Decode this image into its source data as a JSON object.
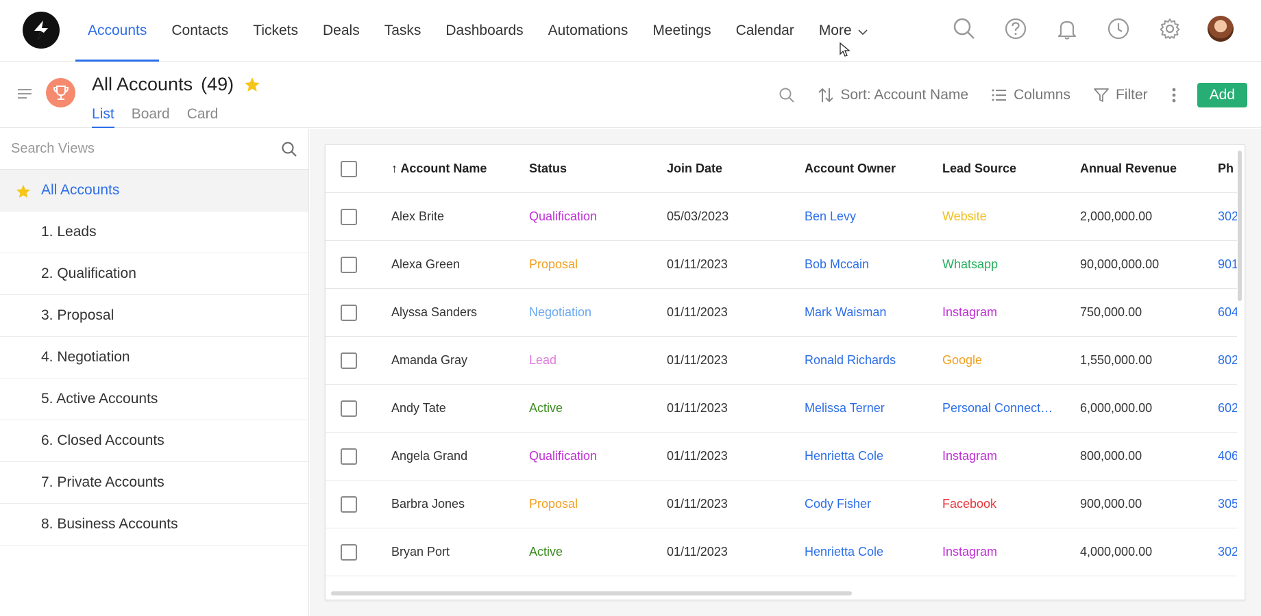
{
  "nav": {
    "items": [
      {
        "label": "Accounts",
        "active": true
      },
      {
        "label": "Contacts"
      },
      {
        "label": "Tickets"
      },
      {
        "label": "Deals"
      },
      {
        "label": "Tasks"
      },
      {
        "label": "Dashboards"
      },
      {
        "label": "Automations"
      },
      {
        "label": "Meetings"
      },
      {
        "label": "Calendar"
      }
    ],
    "more_label": "More",
    "icons": [
      "search-icon",
      "help-icon",
      "bell-icon",
      "clock-icon",
      "gear-icon"
    ]
  },
  "header": {
    "title": "All Accounts",
    "count": "(49)",
    "view_tabs": [
      "List",
      "Board",
      "Card"
    ],
    "sort_label": "Sort: Account Name",
    "columns_label": "Columns",
    "filter_label": "Filter",
    "add_label": "Add"
  },
  "sidebar": {
    "search_placeholder": "Search Views",
    "views": [
      {
        "label": "All Accounts",
        "active": true
      },
      {
        "label": "1. Leads"
      },
      {
        "label": "2. Qualification"
      },
      {
        "label": "3. Proposal"
      },
      {
        "label": "4. Negotiation"
      },
      {
        "label": "5. Active Accounts"
      },
      {
        "label": "6. Closed Accounts"
      },
      {
        "label": "7. Private Accounts"
      },
      {
        "label": "8. Business Accounts"
      }
    ]
  },
  "table": {
    "columns": [
      "Account Name",
      "Status",
      "Join Date",
      "Account Owner",
      "Lead Source",
      "Annual Revenue",
      "Ph"
    ],
    "sort_arrow": "↑",
    "rows": [
      {
        "name": "Alex Brite",
        "status": "Qualification",
        "join_date": "05/03/2023",
        "owner": "Ben Levy",
        "source": "Website",
        "revenue": "2,000,000.00",
        "phone": "302"
      },
      {
        "name": "Alexa Green",
        "status": "Proposal",
        "join_date": "01/11/2023",
        "owner": "Bob Mccain",
        "source": "Whatsapp",
        "revenue": "90,000,000.00",
        "phone": "901"
      },
      {
        "name": "Alyssa Sanders",
        "status": "Negotiation",
        "join_date": "01/11/2023",
        "owner": "Mark Waisman",
        "source": "Instagram",
        "revenue": "750,000.00",
        "phone": "604"
      },
      {
        "name": "Amanda Gray",
        "status": "Lead",
        "join_date": "01/11/2023",
        "owner": "Ronald Richards",
        "source": "Google",
        "revenue": "1,550,000.00",
        "phone": "802"
      },
      {
        "name": "Andy Tate",
        "status": "Active",
        "join_date": "01/11/2023",
        "owner": "Melissa Terner",
        "source": "Personal Connect…",
        "revenue": "6,000,000.00",
        "phone": "602"
      },
      {
        "name": "Angela Grand",
        "status": "Qualification",
        "join_date": "01/11/2023",
        "owner": "Henrietta Cole",
        "source": "Instagram",
        "revenue": "800,000.00",
        "phone": "406"
      },
      {
        "name": "Barbra Jones",
        "status": "Proposal",
        "join_date": "01/11/2023",
        "owner": "Cody Fisher",
        "source": "Facebook",
        "revenue": "900,000.00",
        "phone": "305"
      },
      {
        "name": "Bryan Port",
        "status": "Active",
        "join_date": "01/11/2023",
        "owner": "Henrietta Cole",
        "source": "Instagram",
        "revenue": "4,000,000.00",
        "phone": "302"
      }
    ]
  },
  "colors": {
    "accent": "#2c6ee8",
    "add_button": "#27ae74",
    "star": "#f5c518",
    "status": {
      "Qualification": "#c02fd6",
      "Proposal": "#f0a020",
      "Negotiation": "#6aa8ef",
      "Lead": "#e07ae0",
      "Active": "#3a8a1e"
    },
    "source": {
      "Website": "#f0c020",
      "Whatsapp": "#27ae60",
      "Instagram": "#c02fd6",
      "Google": "#f0a020",
      "Personal Connect…": "#2c6ee8",
      "Facebook": "#e8343a"
    }
  }
}
